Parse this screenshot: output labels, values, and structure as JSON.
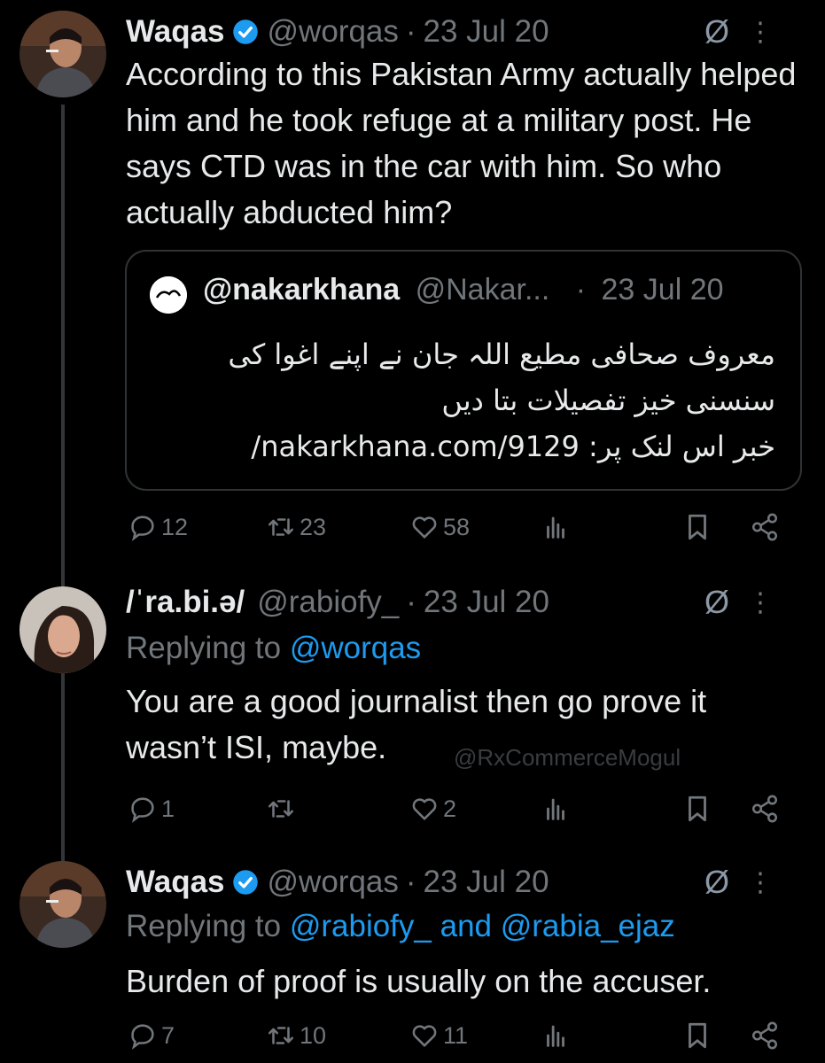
{
  "tweets": [
    {
      "name": "Waqas",
      "handle": "@worqas",
      "date": "23 Jul 20",
      "dot": "·",
      "text": "According to this Pakistan Army actually helped him and he took refuge at a military post. He says CTD was in the car with him. So who actually abducted him?",
      "quote": {
        "name": "@nakarkhana",
        "handle": "@Nakar...",
        "date": "23 Jul 20",
        "line1": "معروف صحافی مطیع اللہ جان نے اپنے اغوا کی",
        "line2": "سنسنی خیز تفصیلات بتا دیں",
        "line3": "خبر اس لنک پر: nakarkhana.com/9129/"
      },
      "stats": {
        "replies": "12",
        "retweets": "23",
        "likes": "58"
      }
    },
    {
      "name": "/ˈra.bi.ə/",
      "handle": "@rabiofy_",
      "date": "23 Jul 20",
      "dot": "·",
      "reply_prefix": "Replying to ",
      "reply_mention": "@worqas",
      "text": "You are a good journalist then go prove it wasn’t ISI, maybe.",
      "watermark": "@RxCommerceMogul",
      "stats": {
        "replies": "1",
        "retweets": "",
        "likes": "2"
      }
    },
    {
      "name": "Waqas",
      "handle": "@worqas",
      "date": "23 Jul 20",
      "dot": "·",
      "reply_prefix": "Replying to ",
      "reply_mention": "@rabiofy_ and @rabia_ejaz",
      "text": "Burden of proof is usually on the accuser.",
      "stats": {
        "replies": "7",
        "retweets": "10",
        "likes": "11"
      }
    }
  ],
  "icons": {
    "grok": "Ø",
    "more": "⋮"
  },
  "colors": {
    "accent": "#1d9bf0",
    "muted": "#71767b",
    "text": "#e7e9ea",
    "background": "#000000"
  }
}
